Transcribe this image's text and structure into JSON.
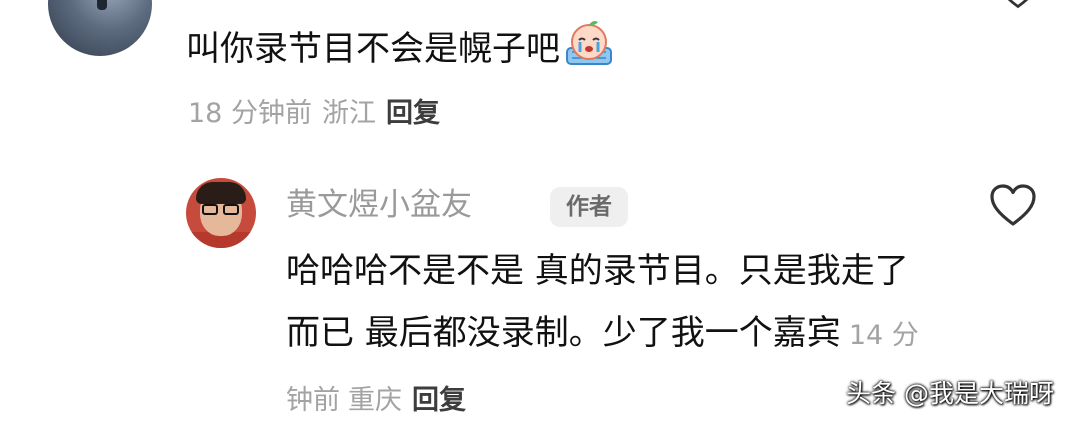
{
  "top_comment": {
    "text": "叫你录节目不会是幌子吧",
    "emoji": "crying-peach-emoji",
    "time": "18 分钟前",
    "location": "浙江",
    "reply_label": "回复"
  },
  "reply_comment": {
    "author": "黄文煜小盆友",
    "badge": "作者",
    "text": "哈哈哈不是不是 真的录节目。只是我走了而已 最后都没录制。少了我一个嘉宾",
    "time": "14 分钟前",
    "location": "重庆",
    "reply_label": "回复"
  },
  "icons": {
    "like": "heart-outline-icon"
  },
  "watermark": "头条 @我是大瑞呀"
}
